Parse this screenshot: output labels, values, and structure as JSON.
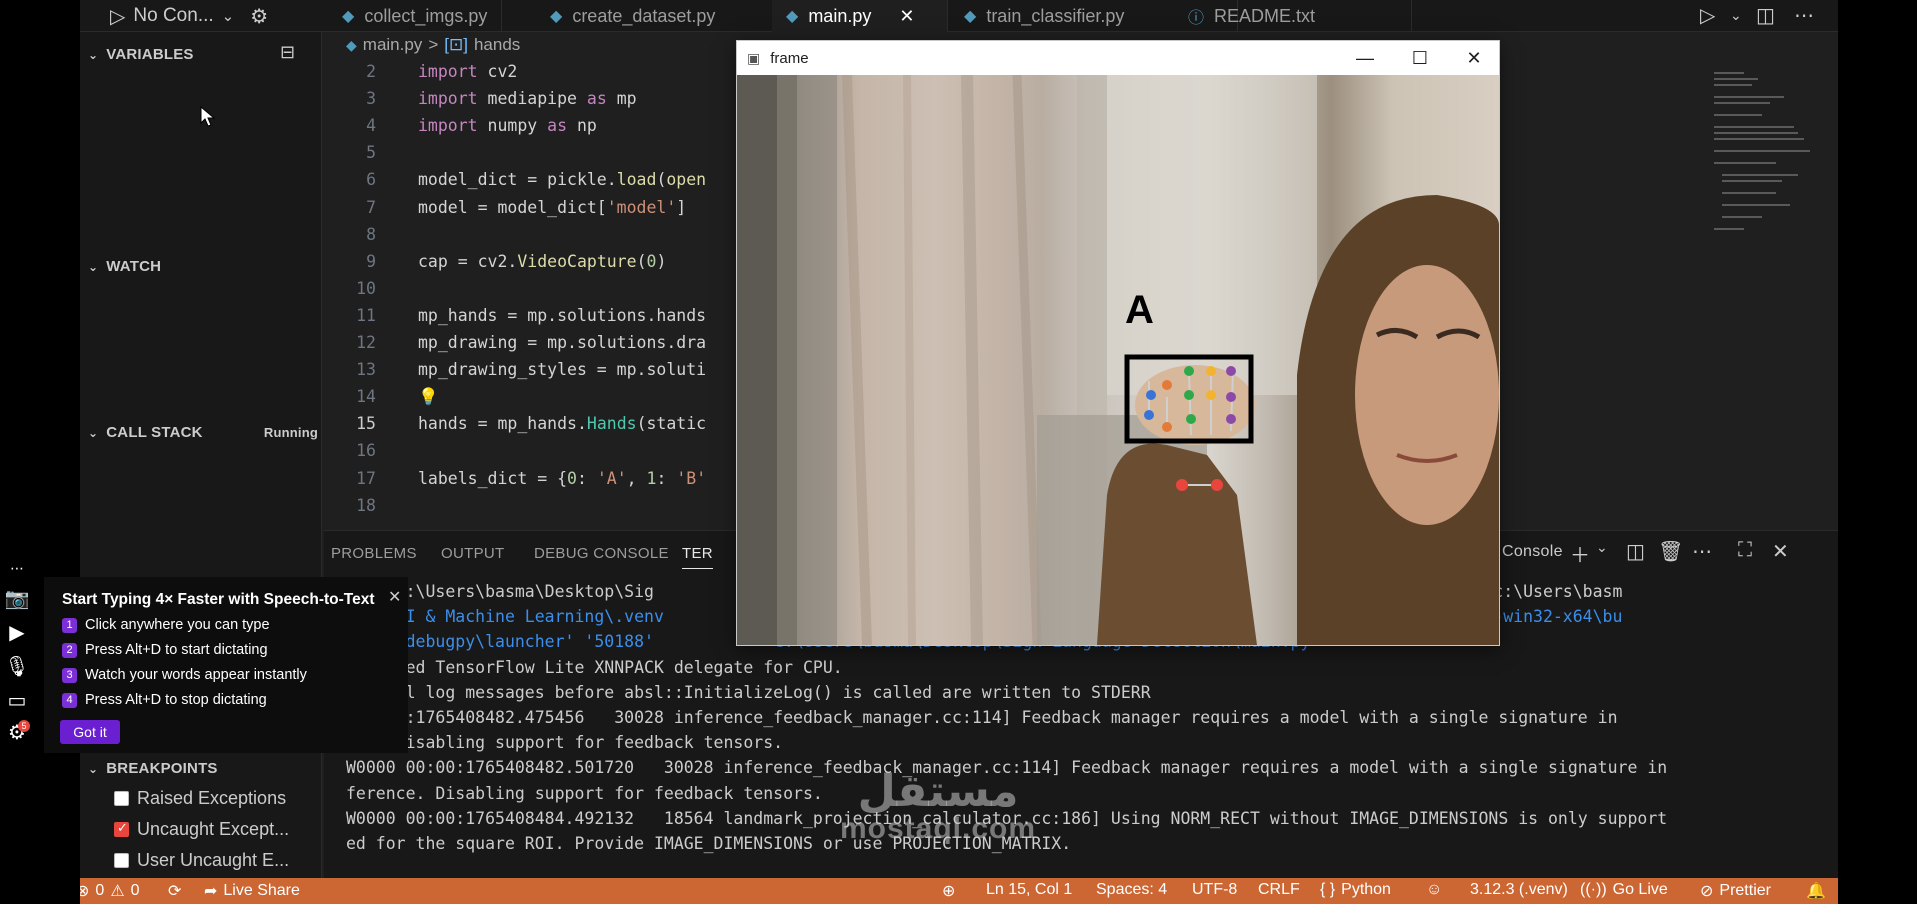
{
  "topbar": {
    "debug_config": "No Con...",
    "tabs": [
      {
        "label": "collect_imgs.py"
      },
      {
        "label": "create_dataset.py"
      },
      {
        "label": "main.py"
      },
      {
        "label": "train_classifier.py"
      },
      {
        "label": "README.txt"
      }
    ]
  },
  "sidebar": {
    "variables": "VARIABLES",
    "watch": "WATCH",
    "call_stack": "CALL STACK",
    "call_stack_status": "Running",
    "breakpoints": "BREAKPOINTS",
    "bp_items": [
      {
        "label": "Raised Exceptions",
        "checked": false
      },
      {
        "label": "Uncaught Except...",
        "checked": true
      },
      {
        "label": "User Uncaught E...",
        "checked": false
      }
    ]
  },
  "breadcrumb": {
    "file": "main.py",
    "sep": ">",
    "symbol": "hands"
  },
  "editor": {
    "lines": [
      {
        "n": "2",
        "tokens": [
          [
            "kw",
            "import"
          ],
          [
            "p",
            " cv2"
          ]
        ]
      },
      {
        "n": "3",
        "tokens": [
          [
            "kw",
            "import"
          ],
          [
            "p",
            " mediapipe "
          ],
          [
            "kw",
            "as"
          ],
          [
            "p",
            " mp"
          ]
        ]
      },
      {
        "n": "4",
        "tokens": [
          [
            "kw",
            "import"
          ],
          [
            "p",
            " numpy "
          ],
          [
            "kw",
            "as"
          ],
          [
            "p",
            " np"
          ]
        ]
      },
      {
        "n": "5",
        "tokens": []
      },
      {
        "n": "6",
        "tokens": [
          [
            "p",
            "model_dict = pickle."
          ],
          [
            "fn",
            "load"
          ],
          [
            "p",
            "("
          ],
          [
            "fn",
            "open"
          ]
        ]
      },
      {
        "n": "7",
        "tokens": [
          [
            "p",
            "model = model_dict["
          ],
          [
            "str",
            "'model'"
          ],
          [
            "p",
            "]"
          ]
        ]
      },
      {
        "n": "8",
        "tokens": []
      },
      {
        "n": "9",
        "tokens": [
          [
            "p",
            "cap = cv2."
          ],
          [
            "fn",
            "VideoCapture"
          ],
          [
            "p",
            "("
          ],
          [
            "num",
            "0"
          ],
          [
            "p",
            ")"
          ]
        ]
      },
      {
        "n": "10",
        "tokens": []
      },
      {
        "n": "11",
        "tokens": [
          [
            "p",
            "mp_hands = mp.solutions.hands"
          ]
        ]
      },
      {
        "n": "12",
        "tokens": [
          [
            "p",
            "mp_drawing = mp.solutions.dra"
          ]
        ]
      },
      {
        "n": "13",
        "tokens": [
          [
            "p",
            "mp_drawing_styles = mp.soluti"
          ]
        ]
      },
      {
        "n": "14",
        "tokens": [
          [
            "bulb",
            "💡"
          ]
        ]
      },
      {
        "n": "15",
        "tokens": [
          [
            "p",
            "hands = mp_hands."
          ],
          [
            "cls",
            "Hands"
          ],
          [
            "p",
            "(static"
          ]
        ]
      },
      {
        "n": "16",
        "tokens": []
      },
      {
        "n": "17",
        "tokens": [
          [
            "p",
            "labels_dict = {"
          ],
          [
            "num",
            "0"
          ],
          [
            "p",
            ": "
          ],
          [
            "str",
            "'A'"
          ],
          [
            "p",
            ", "
          ],
          [
            "num",
            "1"
          ],
          [
            "p",
            ": "
          ],
          [
            "str",
            "'B'"
          ]
        ]
      },
      {
        "n": "18",
        "tokens": []
      }
    ]
  },
  "panel": {
    "tabs": [
      "PROBLEMS",
      "OUTPUT",
      "DEBUG CONSOLE",
      "TER"
    ],
    "console_label": "Console",
    "terminal_lines": [
      {
        "text": ") PS C:\\Users\\basma\\Desktop\\Sig",
        "right": "ction'; & 'c:\\Users\\basm"
      },
      {
        "text": "ktop\\AI & Machine Learning\\.venv",
        "right": "y-2025.16.0-win32-x64\\bu",
        "blue": true
      },
      {
        "text": "\\libs\\debugpy\\launcher' '50188'",
        "right": "C:\\Users\\basma\\Desktop\\Sign Language Detection\\main.py",
        "blue": true
      },
      {
        "text": " Created TensorFlow Lite XNNPACK delegate for CPU."
      },
      {
        "text": "NG: All log messages before absl::InitializeLog() is called are written to STDERR"
      },
      {
        "text": " 00:00:1765408482.475456   30028 inference_feedback_manager.cc:114] Feedback manager requires a model with a single signature in"
      },
      {
        "text": "nce. Disabling support for feedback tensors."
      },
      {
        "text": "W0000 00:00:1765408482.501720   30028 inference_feedback_manager.cc:114] Feedback manager requires a model with a single signature in"
      },
      {
        "text": "ference. Disabling support for feedback tensors."
      },
      {
        "text": "W0000 00:00:1765408484.492132   18564 landmark_projection_calculator.cc:186] Using NORM_RECT without IMAGE_DIMENSIONS is only support"
      },
      {
        "text": "ed for the square ROI. Provide IMAGE_DIMENSIONS or use PROJECTION_MATRIX."
      },
      {
        "text": ""
      }
    ]
  },
  "statusbar": {
    "errors": "0",
    "warnings": "0",
    "live_share": "Live Share",
    "position": "Ln 15, Col 1",
    "spaces": "Spaces: 4",
    "encoding": "UTF-8",
    "eol": "CRLF",
    "language": "Python",
    "interpreter": "3.12.3 (.venv)",
    "go_live": "Go Live",
    "prettier": "Prettier"
  },
  "frame_window": {
    "title": "frame",
    "prediction_label": "A"
  },
  "popup": {
    "title": "Start Typing 4× Faster with Speech-to-Text",
    "steps": [
      {
        "n": "1",
        "text": "Click anywhere you can type"
      },
      {
        "n": "2",
        "text": "Press Alt+D to start dictating"
      },
      {
        "n": "3",
        "text": "Watch your words appear instantly"
      },
      {
        "n": "4",
        "text": "Press Alt+D to stop dictating"
      }
    ],
    "button": "Got it",
    "badge": "5"
  },
  "watermark": {
    "arabic": "مستقل",
    "latin": "mostaql.com"
  },
  "colors": {
    "statusbar": "#cc6633",
    "editor_bg": "#1f1f1f",
    "popup_accent": "#7b2fd6"
  }
}
